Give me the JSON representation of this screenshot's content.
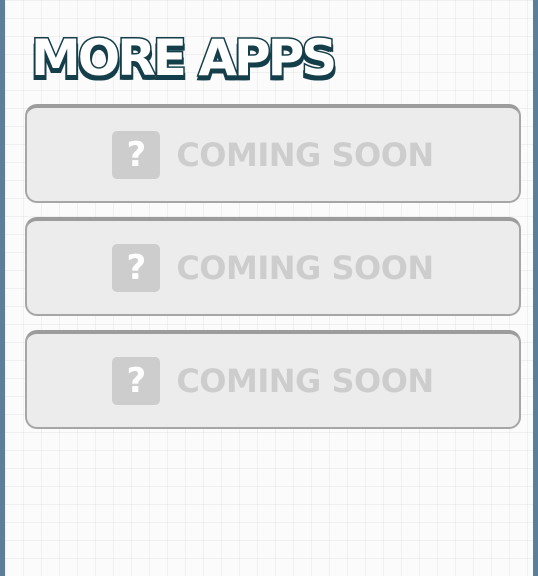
{
  "header": {
    "title": "MORE APPS"
  },
  "apps": [
    {
      "label": "COMING SOON",
      "icon": "question-mark-icon",
      "icon_glyph": "?"
    },
    {
      "label": "COMING SOON",
      "icon": "question-mark-icon",
      "icon_glyph": "?"
    },
    {
      "label": "COMING SOON",
      "icon": "question-mark-icon",
      "icon_glyph": "?"
    }
  ],
  "colors": {
    "frame": "#5b7f99",
    "background": "#fbfbfb",
    "title_fill": "#ffffff",
    "title_outline": "#143e4a",
    "card_fill": "#ececec",
    "card_border": "#a6a6a6",
    "placeholder": "#cdcdcd"
  }
}
